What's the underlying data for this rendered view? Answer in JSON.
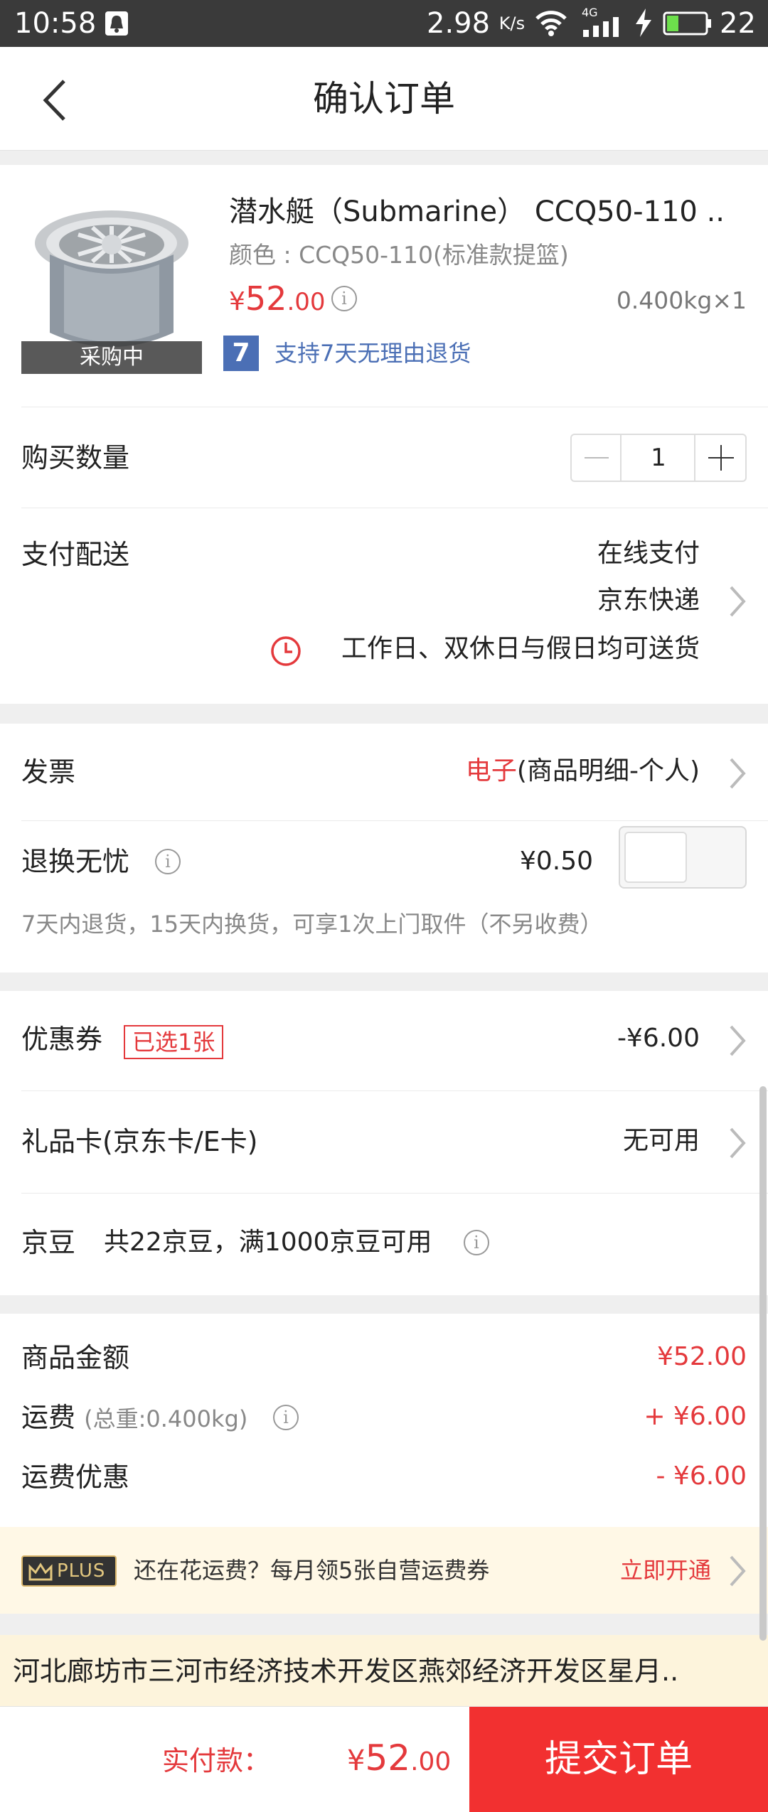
{
  "status_bar": {
    "time": "10:58",
    "speed": "2.98",
    "speed_unit": "K/s",
    "network": "4G",
    "battery": "22"
  },
  "header": {
    "title": "确认订单"
  },
  "product": {
    "name": "潜水艇（Submarine） CCQ50-110 ..",
    "spec": "颜色 : CCQ50-110(标准款提篮)",
    "price_currency": "¥",
    "price_int": "52",
    "price_dec": ".00",
    "weight_qty": "0.400kg×1",
    "status": "采购中",
    "return_icon_text": "7",
    "return_policy": "支持7天无理由退货"
  },
  "quantity": {
    "label": "购买数量",
    "value": "1"
  },
  "payment": {
    "label": "支付配送",
    "method": "在线支付",
    "delivery": "京东快递",
    "delivery_time": "工作日、双休日与假日均可送货"
  },
  "invoice": {
    "label": "发票",
    "type": "电子",
    "detail": "(商品明细-个人)"
  },
  "worry_free": {
    "label": "退换无忧",
    "price": "¥0.50",
    "note": "7天内退货，15天内换货，可享1次上门取件（不另收费）"
  },
  "coupon": {
    "label": "优惠券",
    "badge": "已选1张",
    "value": "-¥6.00"
  },
  "gift_card": {
    "label": "礼品卡(京东卡/E卡)",
    "value": "无可用"
  },
  "jingdou": {
    "label": "京豆",
    "desc": "共22京豆，满1000京豆可用"
  },
  "summary": {
    "goods_label": "商品金额",
    "goods_value": "¥52.00",
    "shipping_label": "运费",
    "shipping_weight": "(总重:0.400kg)",
    "shipping_value": "+ ¥6.00",
    "shipping_discount_label": "运费优惠",
    "shipping_discount_value": "- ¥6.00"
  },
  "plus_promo": {
    "badge": "PLUS",
    "text": "还在花运费？每月领5张自营运费券",
    "action": "立即开通"
  },
  "address": {
    "text": "河北廊坊市三河市经济技术开发区燕郊经济开发区星月.."
  },
  "bottom": {
    "pay_label": "实付款：",
    "pay_currency": "¥",
    "pay_int": "52",
    "pay_dec": ".00",
    "submit_label": "提交订单"
  },
  "colors": {
    "accent_red": "#e4393c",
    "submit_red": "#f23030",
    "link_blue": "#4b6fb5",
    "plus_bg": "#fff8e6",
    "address_bg": "#fdf4dc"
  }
}
